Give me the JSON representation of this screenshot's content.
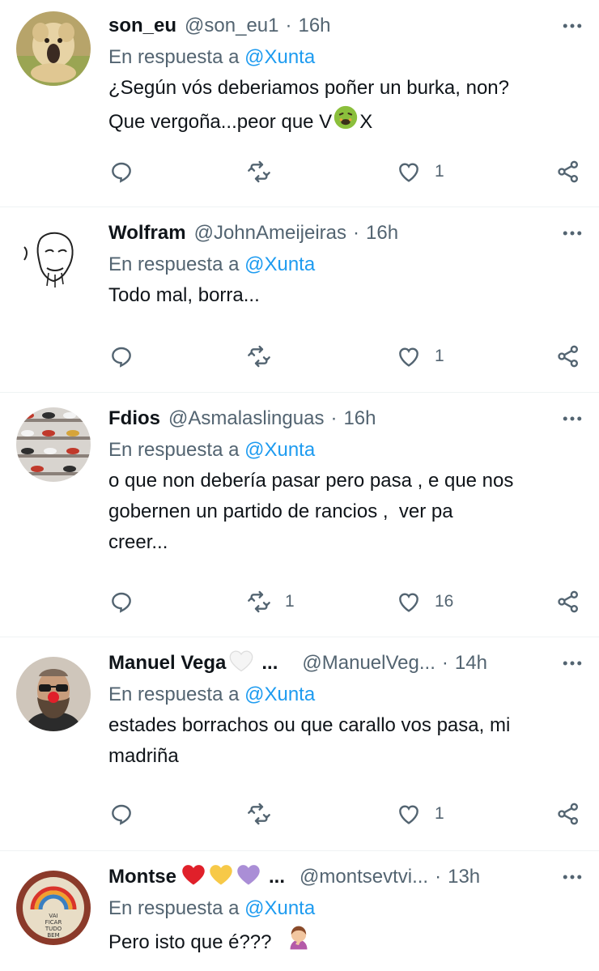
{
  "tweets": [
    {
      "name": "son_eu",
      "handle": "@son_eu1",
      "time": "16h",
      "reply_prefix": "En respuesta a",
      "reply_mention": "@Xunta",
      "text_line1": "¿Según vós deberiamos poñer un burka, non?",
      "text_line2_a": "Que vergoña...peor que V",
      "text_line2_b": "X",
      "retweets": "",
      "likes": "1",
      "avatar_icon": "dog-avatar"
    },
    {
      "name": "Wolfram",
      "handle": "@JohnAmeijeiras",
      "time": "16h",
      "reply_prefix": "En respuesta a",
      "reply_mention": "@Xunta",
      "text": "Todo mal, borra...",
      "retweets": "",
      "likes": "1",
      "avatar_icon": "sketch-face-avatar"
    },
    {
      "name": "Fdios",
      "handle": "@Asmalaslinguas",
      "time": "16h",
      "reply_prefix": "En respuesta a",
      "reply_mention": "@Xunta",
      "text": "o que non debería pasar pero pasa , e que nos\ngobernen un partido de rancios ,  ver pa\ncreer...",
      "retweets": "1",
      "likes": "16",
      "avatar_icon": "shoe-shelf-avatar"
    },
    {
      "name": "Manuel Vega",
      "name_ellipsis": "...",
      "handle": "@ManuelVeg...",
      "time": "14h",
      "reply_prefix": "En respuesta a",
      "reply_mention": "@Xunta",
      "text": "estades borrachos ou que carallo vos pasa, mi\nmadriña",
      "retweets": "",
      "likes": "1",
      "avatar_icon": "clown-nose-man-avatar"
    },
    {
      "name": "Montse",
      "name_ellipsis": "...",
      "handle": "@montsevtvi...",
      "time": "13h",
      "reply_prefix": "En respuesta a",
      "reply_mention": "@Xunta",
      "text": "Pero isto que é???",
      "avatar_icon": "rainbow-badge-avatar",
      "badge_text_1": "VAI",
      "badge_text_2": "FICAR",
      "badge_text_3": "TUDO",
      "badge_text_4": "BEM"
    }
  ],
  "separator": "·",
  "colors": {
    "link": "#1d9bf0",
    "muted": "#536471",
    "text": "#0f1419",
    "divider": "#eff3f4"
  }
}
